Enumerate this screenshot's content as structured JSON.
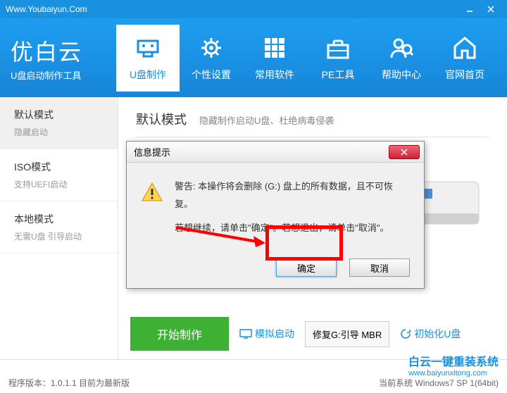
{
  "titlebar": {
    "url": "Www.Youbaiyun.Com"
  },
  "logo": {
    "title": "优白云",
    "subtitle": "U盘启动制作工具"
  },
  "nav": [
    {
      "label": "U盘制作"
    },
    {
      "label": "个性设置"
    },
    {
      "label": "常用软件"
    },
    {
      "label": "PE工具"
    },
    {
      "label": "帮助中心"
    },
    {
      "label": "官网首页"
    }
  ],
  "sidebar": [
    {
      "title": "默认模式",
      "desc": "隐藏启动"
    },
    {
      "title": "ISO模式",
      "desc": "支持UEFI启动"
    },
    {
      "title": "本地模式",
      "desc": "无需U盘 引导启动"
    }
  ],
  "main": {
    "title": "默认模式",
    "subtitle": "隐藏制作启动U盘、杜绝病毒侵袭"
  },
  "footer": {
    "start": "开始制作",
    "sim": "模拟启动",
    "repair": "修复G:引导 MBR",
    "init": "初始化U盘"
  },
  "status": {
    "left": "程序版本：1.0.1.1  目前为最新版",
    "right": "当前系统 Windows7 SP 1(64bit)",
    "watermark": "白云一键重装系统",
    "watermark_url": "www.baiyunxitong.com"
  },
  "dialog": {
    "title": "信息提示",
    "line1": "警告: 本操作将会删除 (G:) 盘上的所有数据，且不可恢复。",
    "line2": "若想继续，请单击\"确定\"。若想退出，请单击\"取消\"。",
    "ok": "确定",
    "cancel": "取消"
  }
}
